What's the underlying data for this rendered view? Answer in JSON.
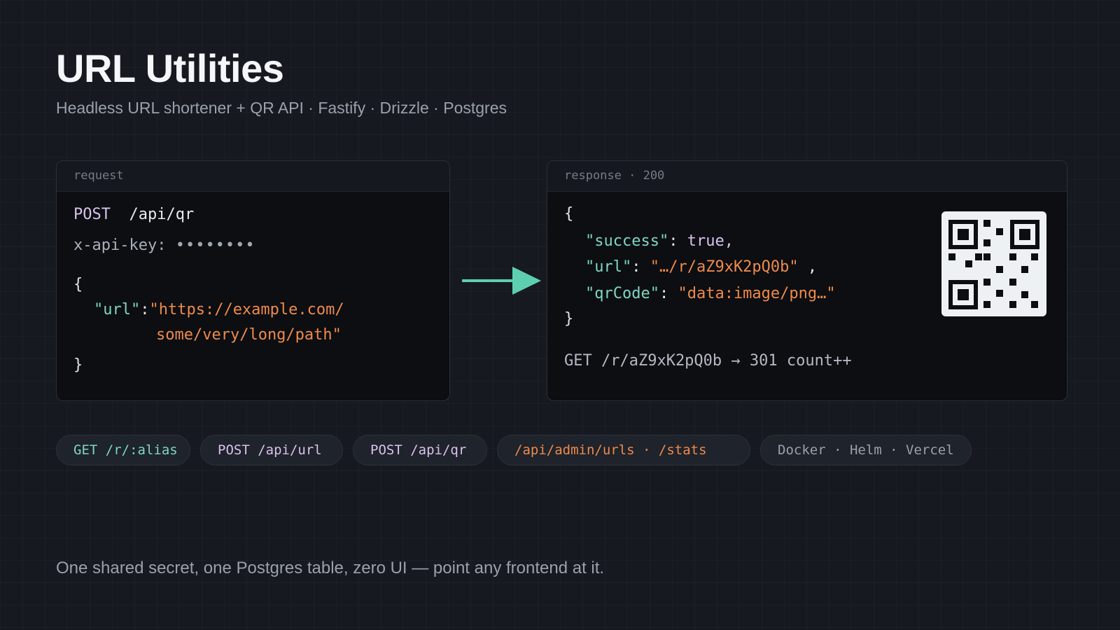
{
  "header": {
    "title": "URL Utilities",
    "subtitle": "Headless URL shortener + QR API · Fastify · Drizzle · Postgres"
  },
  "request": {
    "label": "request",
    "method": "POST",
    "path": "/api/qr",
    "header_name": "x-api-key:",
    "header_value": "••••••••",
    "open_brace": "{",
    "key": "\"url\"",
    "colon": ":",
    "value_line1": "\"https://example.com/",
    "value_line2": "some/very/long/path\"",
    "close_brace": "}"
  },
  "response": {
    "label": "response · 200",
    "open_brace": "{",
    "success_key": "\"success\"",
    "success_value": "true,",
    "url_key": "\"url\"",
    "url_value": "\"…/r/aZ9xK2pQ0b\"",
    "url_comma": ",",
    "qr_key": "\"qrCode\"",
    "qr_value": "\"data:image/png…\"",
    "close_brace": "}",
    "redirect_line": "GET /r/aZ9xK2pQ0b → 301 count++"
  },
  "chips": [
    "GET /r/:alias",
    "POST /api/url",
    "POST /api/qr",
    "/api/admin/urls · /stats",
    "Docker · Helm · Vercel"
  ],
  "footer": {
    "tagline": "One shared secret, one Postgres table, zero UI — point any frontend at it."
  },
  "colors": {
    "background": "#16191f",
    "panel": "#0c0e12",
    "teal": "#5dcfb0",
    "orange": "#ef8a4a",
    "lavender": "#d9c2ee"
  },
  "icons": {
    "arrow": "arrow-right-icon",
    "qr": "qr-code-icon"
  }
}
